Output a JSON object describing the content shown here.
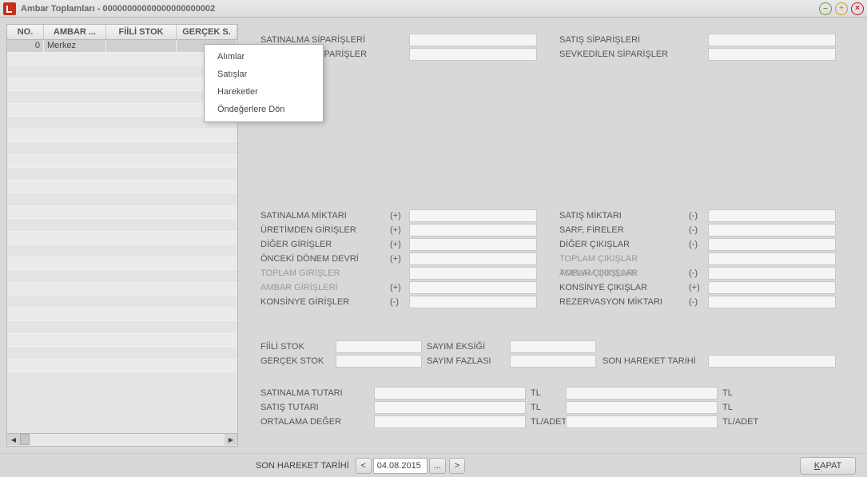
{
  "window": {
    "title": "Ambar Toplamları - 00000000000000000000002"
  },
  "grid": {
    "headers": {
      "c1": "NO.",
      "c2": "AMBAR ...",
      "c3": "FİİLİ STOK",
      "c4": "GERÇEK S."
    },
    "row0": {
      "no": "0",
      "ambar": "Merkez"
    }
  },
  "ctx": {
    "alim": "Alımlar",
    "satis": "Satışlar",
    "hareket": "Hareketler",
    "reset": "Öndeğerlere Dön"
  },
  "labels": {
    "satinalma_sip": "SATINALMA SİPARİŞLERİ",
    "alinan_sip": "              NAN SİPARİŞLER",
    "satis_sip": "SATIŞ SİPARİŞLERİ",
    "sevk_sip": "SEVKEDİLEN SİPARİŞLER",
    "satinalma_mik": "SATINALMA MİKTARI",
    "uretim_gir": "ÜRETİMDEN GİRİŞLER",
    "diger_gir": "DİĞER GİRİŞLER",
    "onceki_donem": "ÖNCEKİ DÖNEM DEVRİ",
    "toplam_gir": "TOPLAM GİRİŞLER",
    "ambar_gir": "AMBAR GİRİŞLERİ",
    "konsinye_gir": "KONSİNYE GİRİŞLER",
    "satis_mik": "SATIŞ MİKTARI",
    "sarf_fire": "SARF, FİRELER",
    "diger_cik": "DİĞER ÇIKIŞLAR",
    "toplam_cik": "TOPLAM ÇIKIŞLAR",
    "ambar_cik": "AMBAR ÇIKIŞLARI",
    "konsinye_cik": "KONSİNYE ÇIKIŞLAR",
    "rezerv_mik": "REZERVASYON MİKTARI",
    "fiili_stok": "FİİLİ STOK",
    "gercek_stok": "GERÇEK STOK",
    "sayim_eksik": "SAYIM EKSİĞİ",
    "sayim_fazla": "SAYIM FAZLASI",
    "son_hareket": "SON HAREKET TARİHİ",
    "satinalma_tut": "SATINALMA TUTARI",
    "satis_tut": "SATIŞ TUTARI",
    "ortalama": "ORTALAMA DEĞER",
    "tl": "TL",
    "tladet": "TL/ADET"
  },
  "ops": {
    "plus": "(+)",
    "minus": "(-)"
  },
  "footer": {
    "label": "SON HAREKET TARİHİ",
    "date": "04.08.2015",
    "prev": "<",
    "next": ">",
    "more": "...",
    "close": "APAT",
    "closeu": "K"
  }
}
